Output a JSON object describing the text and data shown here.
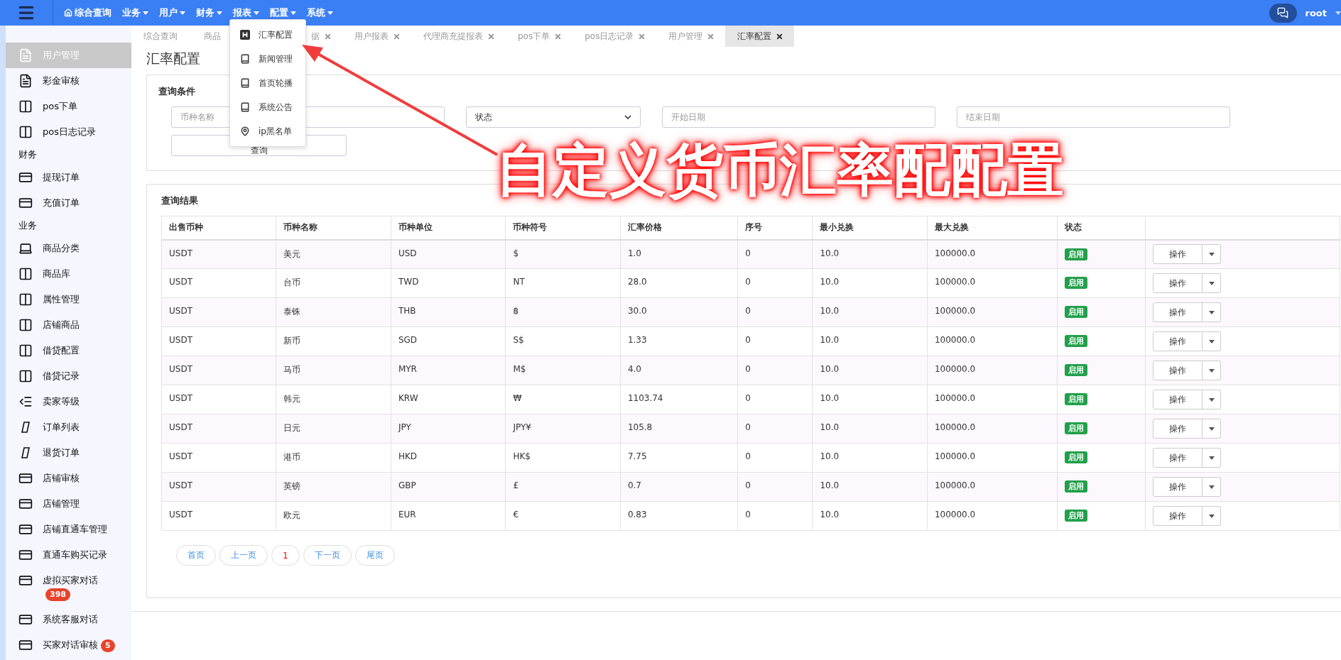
{
  "navbar": {
    "menu": [
      {
        "label": "综合查询",
        "kind": "home"
      },
      {
        "label": "业务",
        "kind": "dropdown"
      },
      {
        "label": "用户",
        "kind": "dropdown"
      },
      {
        "label": "财务",
        "kind": "dropdown"
      },
      {
        "label": "报表",
        "kind": "dropdown"
      },
      {
        "label": "配置",
        "kind": "dropdown"
      },
      {
        "label": "系统",
        "kind": "dropdown"
      }
    ],
    "user": "root"
  },
  "dropdown": {
    "items": [
      {
        "label": "汇率配置",
        "kind": "h-square"
      },
      {
        "label": "新闻管理",
        "kind": "book"
      },
      {
        "label": "首页轮播",
        "kind": "book"
      },
      {
        "label": "系统公告",
        "kind": "book"
      },
      {
        "label": "ip黑名单",
        "kind": "pin"
      }
    ]
  },
  "sidebar": {
    "items": [
      {
        "label": "用户管理",
        "kind": "document",
        "selected": true
      },
      {
        "label": "彩金审核",
        "kind": "document",
        "selected": false
      },
      {
        "label": "pos下单",
        "kind": "columns",
        "selected": false
      },
      {
        "label": "pos日志记录",
        "kind": "columns",
        "selected": false
      },
      {
        "label": "财务",
        "kind": "heading"
      },
      {
        "label": "提现订单",
        "kind": "card",
        "selected": false
      },
      {
        "label": "充值订单",
        "kind": "card",
        "selected": false
      },
      {
        "label": "业务",
        "kind": "heading"
      },
      {
        "label": "商品分类",
        "kind": "laptop",
        "selected": false
      },
      {
        "label": "商品库",
        "kind": "columns",
        "selected": false
      },
      {
        "label": "属性管理",
        "kind": "columns",
        "selected": false
      },
      {
        "label": "店铺商品",
        "kind": "columns",
        "selected": false
      },
      {
        "label": "借贷配置",
        "kind": "columns",
        "selected": false
      },
      {
        "label": "借贷记录",
        "kind": "columns",
        "selected": false
      },
      {
        "label": "卖家等级",
        "kind": "indent",
        "selected": false
      },
      {
        "label": "订单列表",
        "kind": "tablet",
        "selected": false
      },
      {
        "label": "退货订单",
        "kind": "tablet",
        "selected": false
      },
      {
        "label": "店铺审核",
        "kind": "card",
        "selected": false
      },
      {
        "label": "店铺管理",
        "kind": "card",
        "selected": false
      },
      {
        "label": "店铺直通车管理",
        "kind": "card",
        "selected": false
      },
      {
        "label": "直通车购买记录",
        "kind": "card",
        "selected": false
      },
      {
        "label": "虚拟买家对话",
        "kind": "card",
        "selected": false,
        "badge": "398"
      },
      {
        "label": "系统客服对话",
        "kind": "card",
        "selected": false
      },
      {
        "label": "买家对话审核",
        "kind": "card",
        "selected": false,
        "badge": "5"
      }
    ]
  },
  "tabs": [
    {
      "label": "综合查询",
      "closable": false,
      "selected": false
    },
    {
      "label": "商品",
      "closable": false,
      "selected": false
    },
    {
      "label": "据",
      "closable": true,
      "selected": false
    },
    {
      "label": "用户报表",
      "closable": true,
      "selected": false
    },
    {
      "label": "代理商充提报表",
      "closable": true,
      "selected": false
    },
    {
      "label": "pos下单",
      "closable": true,
      "selected": false
    },
    {
      "label": "pos日志记录",
      "closable": true,
      "selected": false
    },
    {
      "label": "用户管理",
      "closable": true,
      "selected": false
    },
    {
      "label": "汇率配置",
      "closable": true,
      "selected": true
    }
  ],
  "page_title": "汇率配置",
  "query": {
    "title": "查询条件",
    "fields": [
      {
        "kind": "input",
        "placeholder": "币种名称"
      },
      {
        "kind": "select",
        "value": "状态"
      },
      {
        "kind": "input",
        "placeholder": "开始日期"
      },
      {
        "kind": "input",
        "placeholder": "结束日期"
      }
    ],
    "button": "查询"
  },
  "results": {
    "title": "查询结果",
    "columns": [
      "出售币种",
      "币种名称",
      "币种单位",
      "币种符号",
      "汇率价格",
      "序号",
      "最小兑换",
      "最大兑换",
      "状态"
    ],
    "rows": [
      {
        "cells": [
          "USDT",
          "美元",
          "USD",
          "$",
          "1.0",
          "0",
          "10.0",
          "100000.0"
        ],
        "status": "启用",
        "action": "操作"
      },
      {
        "cells": [
          "USDT",
          "台币",
          "TWD",
          "NT",
          "28.0",
          "0",
          "10.0",
          "100000.0"
        ],
        "status": "启用",
        "action": "操作"
      },
      {
        "cells": [
          "USDT",
          "泰铢",
          "THB",
          "฿",
          "30.0",
          "0",
          "10.0",
          "100000.0"
        ],
        "status": "启用",
        "action": "操作"
      },
      {
        "cells": [
          "USDT",
          "新币",
          "SGD",
          "S$",
          "1.33",
          "0",
          "10.0",
          "100000.0"
        ],
        "status": "启用",
        "action": "操作"
      },
      {
        "cells": [
          "USDT",
          "马币",
          "MYR",
          "M$",
          "4.0",
          "0",
          "10.0",
          "100000.0"
        ],
        "status": "启用",
        "action": "操作"
      },
      {
        "cells": [
          "USDT",
          "韩元",
          "KRW",
          "₩",
          "1103.74",
          "0",
          "10.0",
          "100000.0"
        ],
        "status": "启用",
        "action": "操作"
      },
      {
        "cells": [
          "USDT",
          "日元",
          "JPY",
          "JPY¥",
          "105.8",
          "0",
          "10.0",
          "100000.0"
        ],
        "status": "启用",
        "action": "操作"
      },
      {
        "cells": [
          "USDT",
          "港币",
          "HKD",
          "HK$",
          "7.75",
          "0",
          "10.0",
          "100000.0"
        ],
        "status": "启用",
        "action": "操作"
      },
      {
        "cells": [
          "USDT",
          "英镑",
          "GBP",
          "£",
          "0.7",
          "0",
          "10.0",
          "100000.0"
        ],
        "status": "启用",
        "action": "操作"
      },
      {
        "cells": [
          "USDT",
          "欧元",
          "EUR",
          "€",
          "0.83",
          "0",
          "10.0",
          "100000.0"
        ],
        "status": "启用",
        "action": "操作"
      }
    ],
    "pagination": [
      {
        "label": "首页",
        "selected": false
      },
      {
        "label": "上一页",
        "selected": false
      },
      {
        "label": "1",
        "selected": true
      },
      {
        "label": "下一页",
        "selected": false
      },
      {
        "label": "尾页",
        "selected": false
      }
    ]
  },
  "annotation": "自定义货币汇率配配置"
}
